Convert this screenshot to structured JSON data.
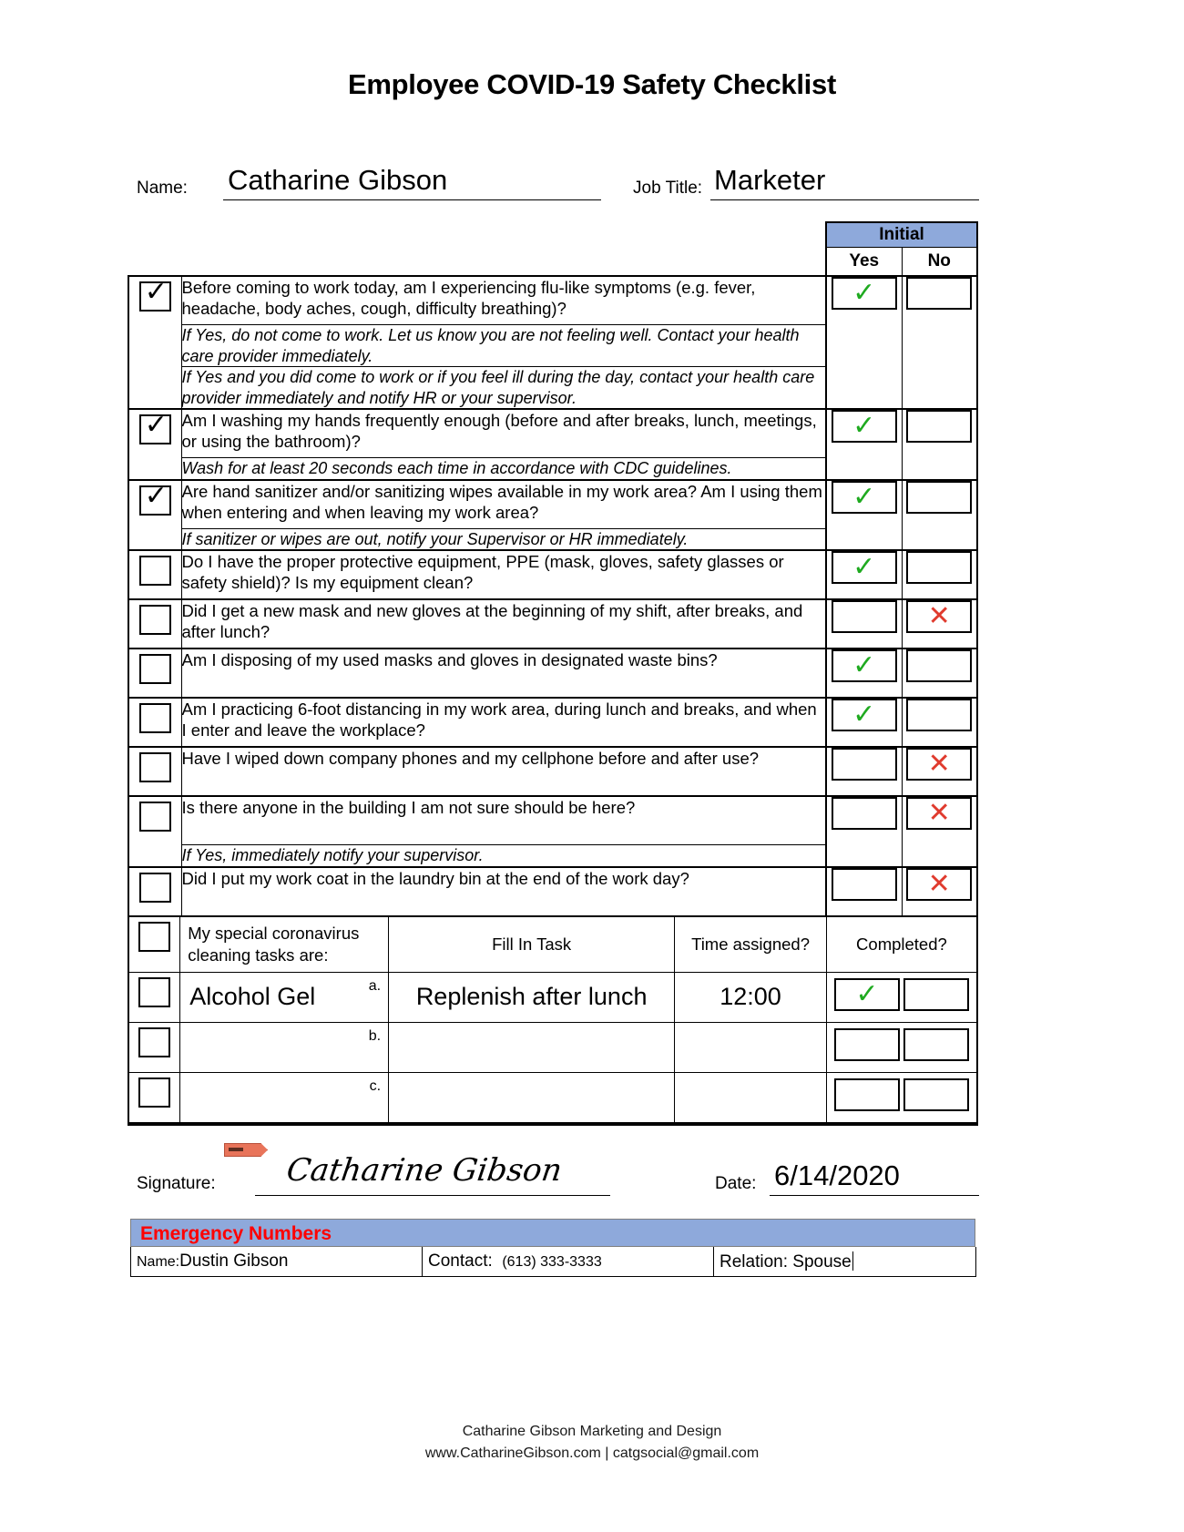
{
  "document": {
    "title": "Employee COVID-19 Safety Checklist"
  },
  "identity": {
    "name_label": "Name:",
    "name_value": "Catharine Gibson",
    "job_title_label": "Job Title:",
    "job_title_value": "Marketer"
  },
  "table": {
    "headers": {
      "initial": "Initial",
      "yes": "Yes",
      "no": "No"
    },
    "rows": [
      {
        "checked": true,
        "question": "Before coming to work today, am I experiencing flu-like symptoms (e.g. fever, headache, body aches, cough, difficulty breathing)?",
        "answer": "yes",
        "notes": [
          "If Yes, do not come to work. Let us know you are not feeling well. Contact your health care provider immediately.",
          "If Yes and you did come to work or if you feel ill during the day, contact your health care provider immediately and notify HR or your supervisor."
        ]
      },
      {
        "checked": true,
        "question": "Am I washing my hands frequently enough (before and after breaks, lunch, meetings, or using the bathroom)?",
        "answer": "yes",
        "notes": [
          "Wash for at least 20 seconds each time in accordance with CDC guidelines."
        ]
      },
      {
        "checked": true,
        "question": "Are hand sanitizer and/or sanitizing wipes available in my work area? Am I using them when entering and when leaving my work area?",
        "answer": "yes",
        "notes": [
          "If sanitizer or wipes are out, notify your Supervisor or HR immediately."
        ]
      },
      {
        "checked": false,
        "question": "Do I have the proper protective equipment, PPE (mask, gloves, safety glasses or safety shield)? Is my equipment clean?",
        "answer": "yes",
        "notes": []
      },
      {
        "checked": false,
        "question": "Did I get a new mask and new gloves at the beginning of my shift, after breaks, and after lunch?",
        "answer": "no",
        "notes": []
      },
      {
        "checked": false,
        "question": "Am I disposing of my used masks and gloves in designated waste bins?",
        "answer": "yes",
        "notes": []
      },
      {
        "checked": false,
        "question": "Am I practicing 6-foot distancing in my work area, during lunch and breaks, and when I enter and leave the workplace?",
        "answer": "yes",
        "notes": []
      },
      {
        "checked": false,
        "question": "Have I wiped down company phones and my cellphone before and after use?",
        "answer": "no",
        "notes": []
      },
      {
        "checked": false,
        "question": "Is there anyone in the building I am not sure should be here?",
        "answer": "no",
        "notes": [
          "If Yes, immediately notify your supervisor."
        ]
      },
      {
        "checked": false,
        "question": "Did I put my work coat in the laundry bin at the end of the work day?",
        "answer": "no",
        "notes": []
      }
    ]
  },
  "cleaning_tasks": {
    "section_label": "My special coronavirus cleaning tasks are:",
    "col_task": "Fill In Task",
    "col_time": "Time assigned?",
    "col_completed": "Completed?",
    "items": [
      {
        "letter": "a.",
        "name": "Alcohol Gel",
        "task": "Replenish after lunch",
        "time": "12:00",
        "completed": "yes"
      },
      {
        "letter": "b.",
        "name": "",
        "task": "",
        "time": "",
        "completed": ""
      },
      {
        "letter": "c.",
        "name": "",
        "task": "",
        "time": "",
        "completed": ""
      }
    ]
  },
  "signature": {
    "label": "Signature:",
    "value": "Catharine Gibson",
    "date_label": "Date:",
    "date_value": "6/14/2020"
  },
  "emergency": {
    "title": "Emergency Numbers",
    "name_label": "Name:",
    "name_value": "Dustin Gibson",
    "contact_label": "Contact:",
    "contact_value": "(613) 333-3333",
    "relation_label": "Relation:",
    "relation_value": "Spouse"
  },
  "footer": {
    "line1": "Catharine Gibson Marketing and Design",
    "line2": "www.CatharineGibson.com | catgsocial@gmail.com"
  },
  "marks": {
    "check_glyph": "✓",
    "cross_glyph": "✕",
    "box_check_glyph": "✓"
  },
  "colors": {
    "header_blue": "#8ea9db",
    "check_green": "#1faa20",
    "cross_red": "#e03b2e",
    "emergency_red": "#ff0000"
  }
}
